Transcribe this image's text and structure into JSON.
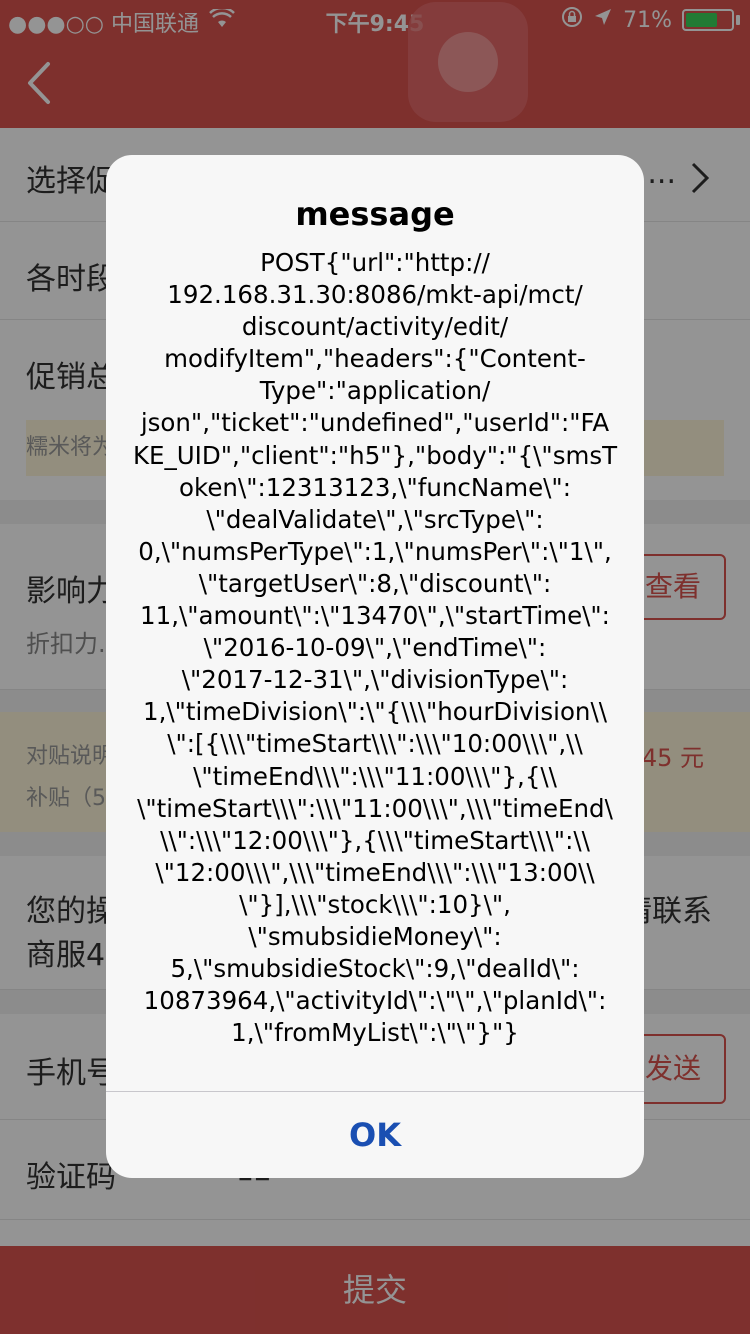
{
  "status_bar": {
    "carrier": "●●●○○ 中国联通",
    "time": "下午9:45",
    "battery_text": "71%",
    "battery_level": 0.71
  },
  "page": {
    "row_promo_label": "选择促",
    "row_promo_value": "...",
    "row_timeslot_label": "各时段",
    "row_total_label": "促销总",
    "notice_1": "糯米将为",
    "row_influence_label": "影响力",
    "row_influence_sub": "折扣力...",
    "view_button": "查看",
    "notice_2_line1": "对贴说明",
    "notice_2_value": "45 元",
    "notice_2_line2": "补贴（5",
    "info_line1_left": "您的操",
    "info_line1_right": "请联系",
    "info_line2": "商服40",
    "phone_label": "手机号",
    "send_button": "发送",
    "code_label": "验证码",
    "code_value": "12",
    "submit": "提交"
  },
  "alert": {
    "title": "message",
    "message": "POST{\"url\":\"http://\n192.168.31.30:8086/mkt-api/mct/\ndiscount/activity/edit/\nmodifyItem\",\"headers\":{\"Content-\nType\":\"application/\njson\",\"ticket\":\"undefined\",\"userId\":\"FA\nKE_UID\",\"client\":\"h5\"},\"body\":\"{\\\"smsT\noken\\\":12313123,\\\"funcName\\\":\n\\\"dealValidate\\\",\\\"srcType\\\":\n0,\\\"numsPerType\\\":1,\\\"numsPer\\\":\\\"1\\\",\n\\\"targetUser\\\":8,\\\"discount\\\":\n11,\\\"amount\\\":\\\"13470\\\",\\\"startTime\\\":\n\\\"2016-10-09\\\",\\\"endTime\\\":\n\\\"2017-12-31\\\",\\\"divisionType\\\":\n1,\\\"timeDivision\\\":\\\"{\\\\\\\"hourDivision\\\\\n\\\":[{\\\\\\\"timeStart\\\\\\\":\\\\\\\"10:00\\\\\\\",\\\\\n\\\"timeEnd\\\\\\\":\\\\\\\"11:00\\\\\\\"},{\\\\\n\\\"timeStart\\\\\\\":\\\\\\\"11:00\\\\\\\",\\\\\\\"timeEnd\\\n\\\\\":\\\\\\\"12:00\\\\\\\"},{\\\\\\\"timeStart\\\\\\\":\\\\\n\\\"12:00\\\\\\\",\\\\\\\"timeEnd\\\\\\\":\\\\\\\"13:00\\\\\n\\\"}],\\\\\\\"stock\\\\\\\":10}\\\",\n\\\"smubsidieMoney\\\":\n5,\\\"smubsidieStock\\\":9,\\\"dealId\\\":\n10873964,\\\"activityId\\\":\\\"\\\",\\\"planId\\\":\n1,\\\"fromMyList\\\":\\\"\\\"}\"}",
    "ok_label": "OK"
  },
  "colors": {
    "brand_red": "#d9534f",
    "alert_button_blue": "#1a4fb2"
  }
}
